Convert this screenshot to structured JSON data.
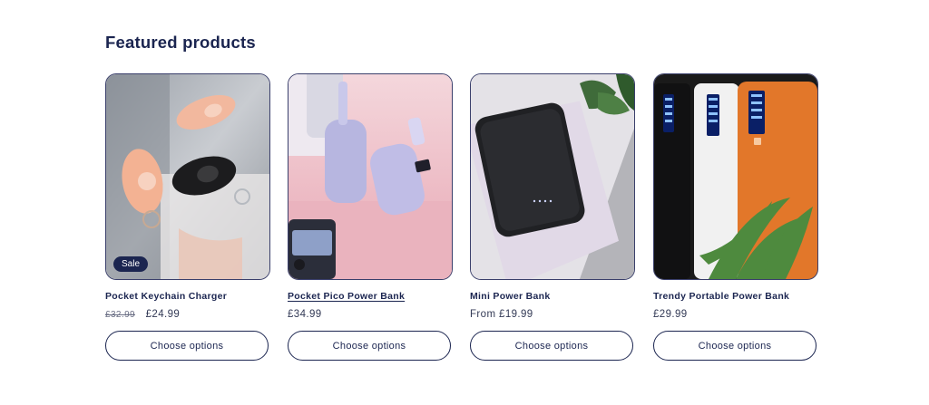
{
  "section": {
    "title": "Featured products"
  },
  "products": [
    {
      "title": "Pocket Keychain Charger",
      "badge": "Sale",
      "price_compare": "£32.99",
      "price": "£24.99",
      "button_label": "Choose options"
    },
    {
      "title": "Pocket Pico Power Bank",
      "price": "£34.99",
      "button_label": "Choose options"
    },
    {
      "title": "Mini Power Bank",
      "price": "From £19.99",
      "button_label": "Choose options"
    },
    {
      "title": "Trendy Portable Power Bank",
      "price": "£29.99",
      "button_label": "Choose options"
    }
  ],
  "colors": {
    "heading": "#1b2550",
    "badge_bg": "#1b2550",
    "border": "#3a3f6b"
  }
}
